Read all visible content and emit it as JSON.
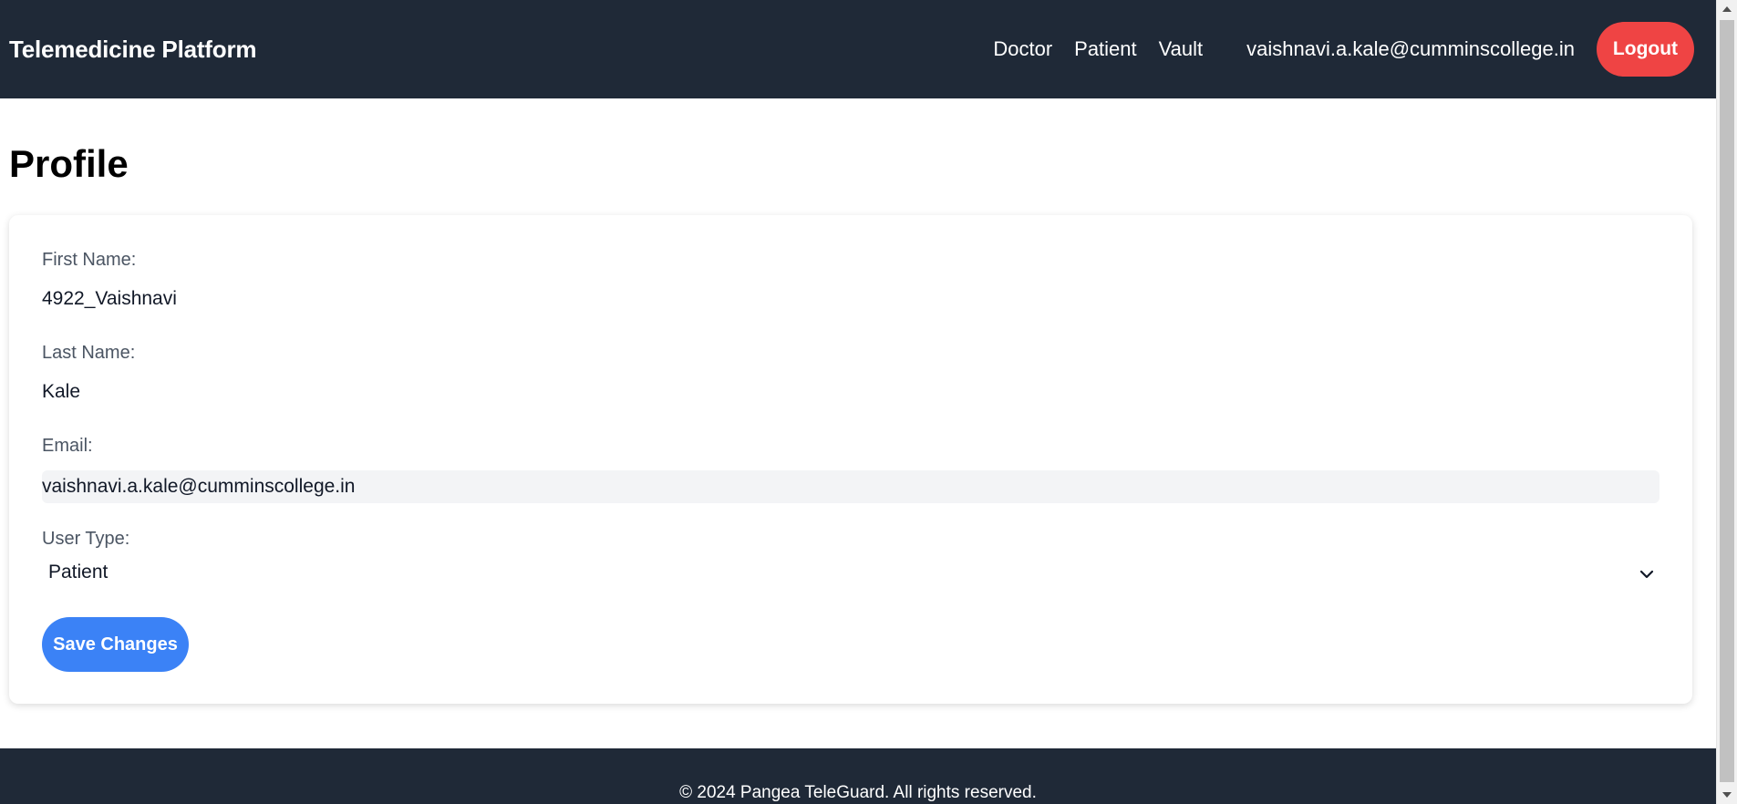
{
  "header": {
    "brand": "Telemedicine Platform",
    "nav": [
      "Doctor",
      "Patient",
      "Vault"
    ],
    "user_email": "vaishnavi.a.kale@cumminscollege.in",
    "logout_label": "Logout"
  },
  "main": {
    "title": "Profile",
    "fields": {
      "first_name_label": "First Name:",
      "first_name_value": "4922_Vaishnavi",
      "last_name_label": "Last Name:",
      "last_name_value": "Kale",
      "email_label": "Email:",
      "email_value": "vaishnavi.a.kale@cumminscollege.in",
      "user_type_label": "User Type:",
      "user_type_value": "Patient"
    },
    "save_label": "Save Changes"
  },
  "footer": {
    "text": "© 2024 Pangea TeleGuard. All rights reserved."
  },
  "colors": {
    "header_bg": "#1f2937",
    "logout": "#ef4444",
    "save": "#3b82f6",
    "input_bg": "#f3f4f6"
  },
  "icons": {
    "select": "chevron-down-icon",
    "scroll_up": "scroll-up-arrow-icon",
    "scroll_down": "scroll-down-arrow-icon"
  }
}
